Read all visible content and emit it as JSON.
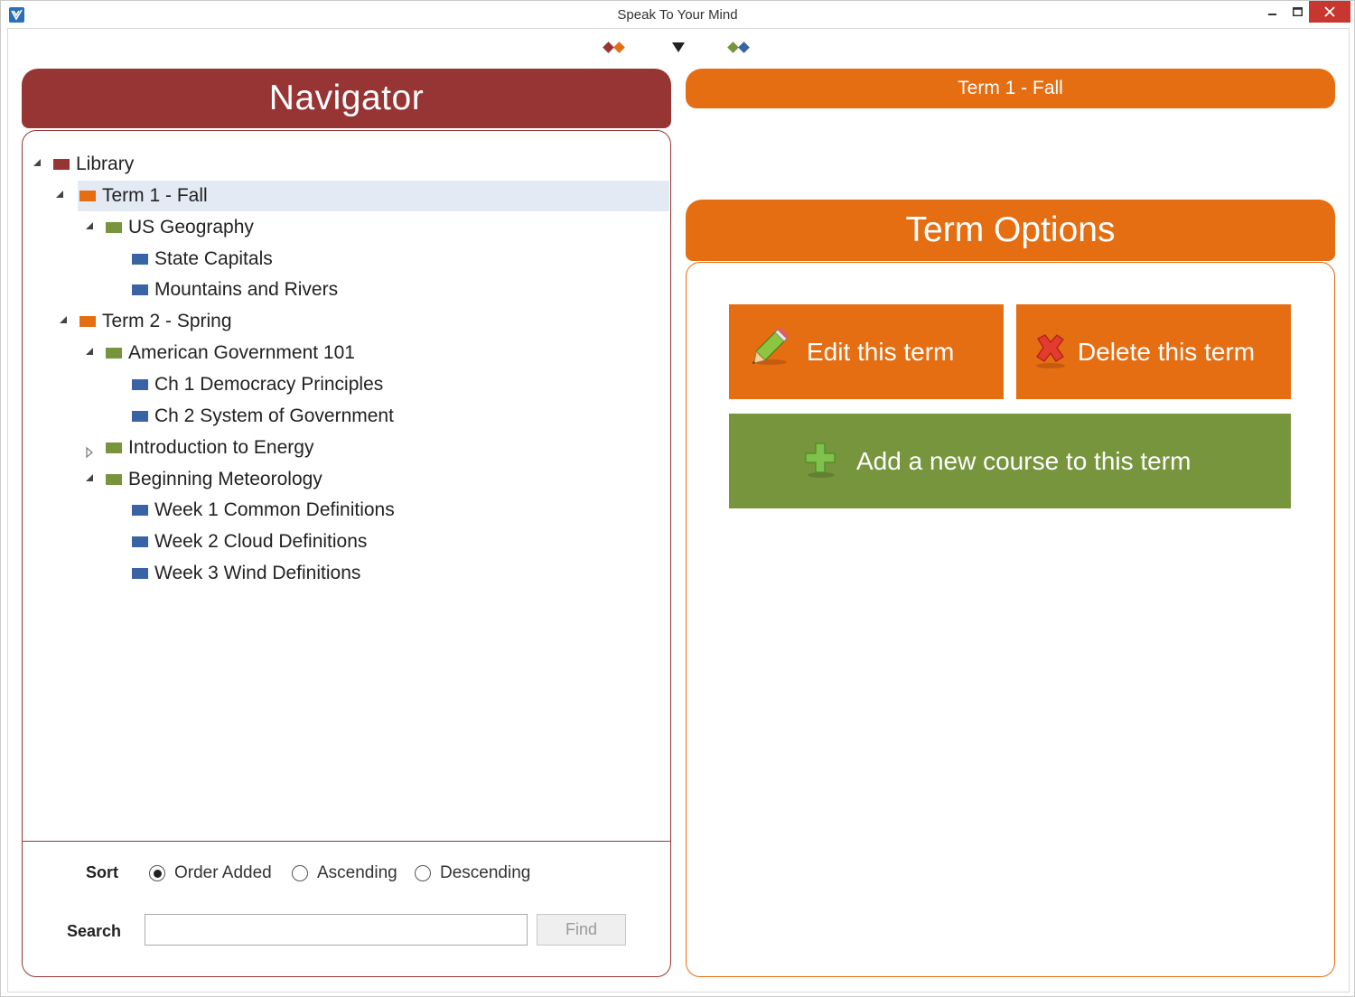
{
  "window": {
    "title": "Speak To Your Mind"
  },
  "colors": {
    "library": "#973535",
    "term": "#e56d12",
    "course": "#77953d",
    "lesson": "#3a63a5"
  },
  "navigator": {
    "title": "Navigator",
    "tree": [
      {
        "label": "Library",
        "level": "library",
        "state": "expanded"
      },
      {
        "label": "Term 1 - Fall",
        "level": "term",
        "state": "expanded",
        "selected": true
      },
      {
        "label": "US Geography",
        "level": "course",
        "state": "expanded"
      },
      {
        "label": "State Capitals",
        "level": "lesson",
        "state": "leaf"
      },
      {
        "label": "Mountains and Rivers",
        "level": "lesson",
        "state": "leaf"
      },
      {
        "label": "Term 2 - Spring",
        "level": "term",
        "state": "expanded"
      },
      {
        "label": "American Government 101",
        "level": "course",
        "state": "expanded"
      },
      {
        "label": "Ch 1 Democracy Principles",
        "level": "lesson",
        "state": "leaf"
      },
      {
        "label": "Ch 2 System of Government",
        "level": "lesson",
        "state": "leaf"
      },
      {
        "label": "Introduction to Energy",
        "level": "course",
        "state": "collapsed"
      },
      {
        "label": "Beginning Meteorology",
        "level": "course",
        "state": "expanded"
      },
      {
        "label": "Week 1 Common Definitions",
        "level": "lesson",
        "state": "leaf"
      },
      {
        "label": "Week 2 Cloud Definitions",
        "level": "lesson",
        "state": "leaf"
      },
      {
        "label": "Week 3 Wind Definitions",
        "level": "lesson",
        "state": "leaf"
      }
    ],
    "sort": {
      "label": "Sort",
      "options": [
        "Order Added",
        "Ascending",
        "Descending"
      ],
      "selected": "Order Added"
    },
    "search": {
      "label": "Search",
      "value": "",
      "find_label": "Find"
    }
  },
  "right": {
    "term_header": "Term 1 - Fall",
    "options_title": "Term Options",
    "edit_label": "Edit this term",
    "delete_label": "Delete this term",
    "add_label": "Add a new course to this term"
  }
}
